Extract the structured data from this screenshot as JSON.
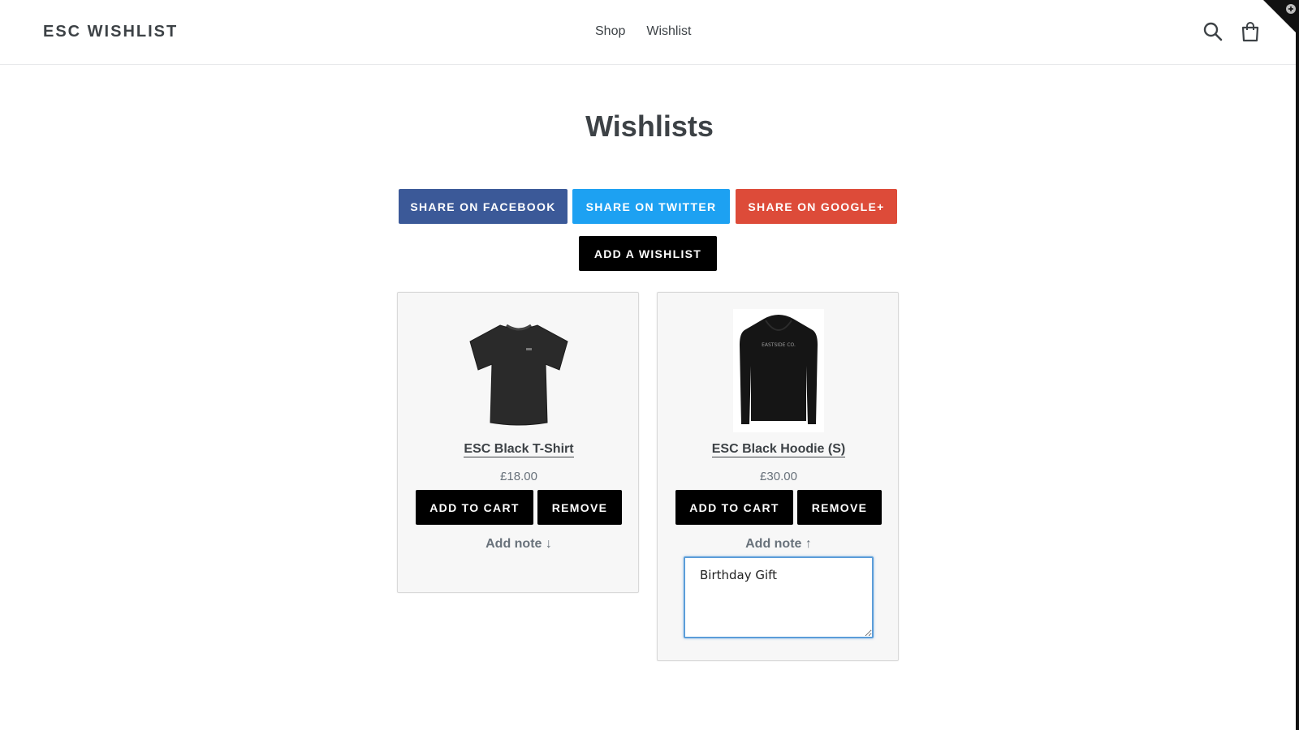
{
  "header": {
    "logo": "ESC WISHLIST",
    "nav": [
      "Shop",
      "Wishlist"
    ],
    "search_icon": "search-icon",
    "cart_icon": "cart-icon"
  },
  "page": {
    "title": "Wishlists"
  },
  "share": {
    "facebook_label": "SHARE ON FACEBOOK",
    "twitter_label": "SHARE ON TWITTER",
    "google_label": "SHARE ON GOOGLE+",
    "colors": {
      "facebook": "#3b5998",
      "twitter": "#1da1f2",
      "google": "#dd4b39"
    }
  },
  "actions": {
    "add_wishlist_label": "ADD A WISHLIST"
  },
  "items": [
    {
      "name": "ESC Black T-Shirt",
      "price": "£18.00",
      "add_to_cart_label": "ADD TO CART",
      "remove_label": "REMOVE",
      "note_label": "Add note ↓",
      "image_icon": "tshirt-icon"
    },
    {
      "name": "ESC Black Hoodie (S)",
      "price": "£30.00",
      "add_to_cart_label": "ADD TO CART",
      "remove_label": "REMOVE",
      "note_label": "Add note ↑",
      "note_value": "Birthday Gift",
      "image_icon": "hoodie-icon",
      "image_text": "EASTSIDE CO."
    }
  ]
}
